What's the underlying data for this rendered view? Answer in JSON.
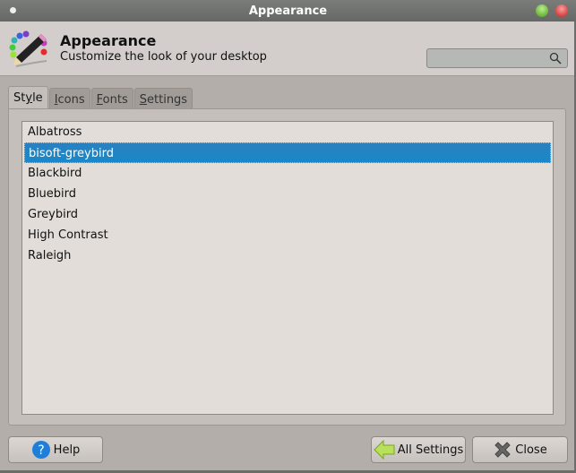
{
  "window": {
    "title": "Appearance"
  },
  "header": {
    "title": "Appearance",
    "subtitle": "Customize the look of your desktop",
    "search": {
      "value": "",
      "placeholder": ""
    }
  },
  "tabs": [
    {
      "label": "Style",
      "mnemonic": "y",
      "active": true
    },
    {
      "label": "Icons",
      "mnemonic": "I"
    },
    {
      "label": "Fonts",
      "mnemonic": "F"
    },
    {
      "label": "Settings",
      "mnemonic": "S"
    }
  ],
  "themes": {
    "items": [
      "Albatross",
      "bisoft-greybird",
      "Blackbird",
      "Bluebird",
      "Greybird",
      "High Contrast",
      "Raleigh"
    ],
    "selected": "bisoft-greybird"
  },
  "buttons": {
    "help": "Help",
    "all_settings": "All Settings",
    "close": "Close"
  },
  "colors": {
    "selection": "#1a88c9",
    "titlebar": "#6b6d6b"
  }
}
